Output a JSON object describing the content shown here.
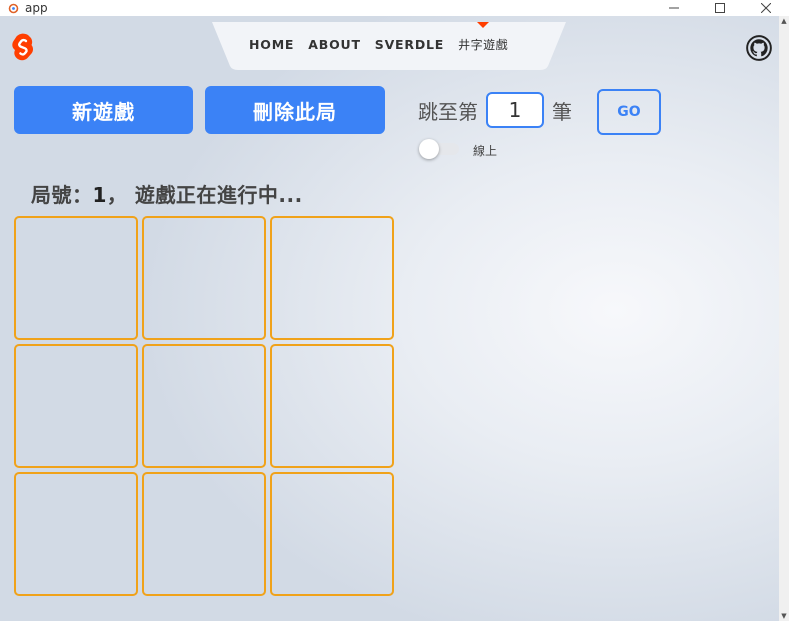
{
  "window": {
    "title": "app",
    "controls": [
      "minimize",
      "maximize",
      "close"
    ]
  },
  "header": {
    "logo_icon": "svelte-logo-icon",
    "nav": [
      {
        "label": "HOME",
        "active": false
      },
      {
        "label": "ABOUT",
        "active": false
      },
      {
        "label": "SVERDLE",
        "active": false
      },
      {
        "label": "井字遊戲",
        "active": true
      }
    ],
    "github_icon": "github-icon"
  },
  "controls": {
    "new_game_label": "新遊戲",
    "delete_game_label": "刪除此局",
    "jump_prefix": "跳至第",
    "jump_value": "1",
    "jump_suffix": "筆",
    "go_label": "GO",
    "online_label": "線上",
    "online_enabled": false
  },
  "status": {
    "game_label": "局號：",
    "game_number": "1",
    "message": "， 遊戲正在進行中..."
  },
  "board": {
    "cells": [
      "",
      "",
      "",
      "",
      "",
      "",
      "",
      "",
      ""
    ]
  },
  "colors": {
    "accent": "#3b82f6",
    "board_border": "#f0a21a",
    "brand": "#ff3e00"
  }
}
